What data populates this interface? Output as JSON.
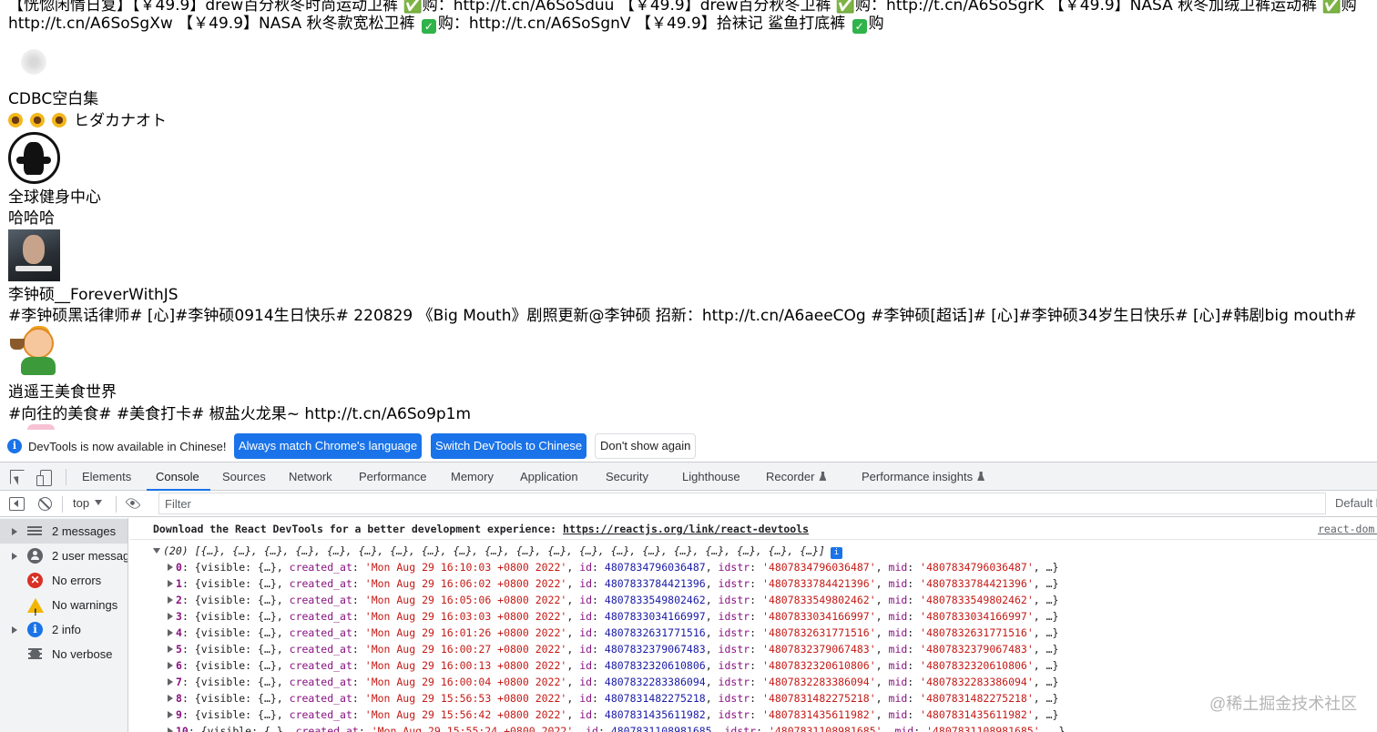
{
  "page": {
    "cut_line": "【恍惚闲情日复】【￥49.9】drew百分秋冬时尚运动卫裤 ✅购：http://t.cn/A6SoSduu 【￥49.9】drew百分秋冬卫裤 ✅购：http://t.cn/A6SoSgrK 【￥49.9】NASA 秋冬加绒卫裤运动裤 ✅购",
    "line1_a": "http://t.cn/A6SoSgXw 【￥49.9】NASA 秋冬款宽松卫裤 ",
    "line1_b": "购：http://t.cn/A6SoSgnV 【￥49.9】拾袜记 鲨鱼打底裤 ",
    "line1_c": "购",
    "check": "✓",
    "posts": [
      {
        "name": "CDBC空白集",
        "text": "ヒダカナオト"
      },
      {
        "name": "全球健身中心",
        "text": "哈哈哈"
      },
      {
        "name": "李钟硕__ForeverWithJS",
        "text": "#李钟硕黑话律师# [心]#李钟硕0914生日快乐# 220829 《Big Mouth》剧照更新@李钟硕 招新：http://t.cn/A6aeeCOg #李钟硕[超话]# [心]#李钟硕34岁生日快乐# [心]#韩剧big mouth#"
      },
      {
        "name": "逍遥王美食世界",
        "text": "#向往的美食# #美食打卡# 椒盐火龙果~  http://t.cn/A6So9p1m"
      }
    ]
  },
  "infobar": {
    "icon": "i",
    "message": "DevTools is now available in Chinese!",
    "btn_match": "Always match Chrome's language",
    "btn_switch": "Switch DevTools to Chinese",
    "btn_dismiss": "Don't show again"
  },
  "tabs": [
    "Elements",
    "Console",
    "Sources",
    "Network",
    "Performance",
    "Memory",
    "Application",
    "Security",
    "Lighthouse",
    "Recorder",
    "Performance insights"
  ],
  "active_tab": "Console",
  "toolbar": {
    "context": "top",
    "filter_placeholder": "Filter",
    "levels": "Default levels"
  },
  "sidebar": {
    "items": [
      {
        "label": "2 messages",
        "icon": "list-icon"
      },
      {
        "label": "2 user messages",
        "icon": "user-icon"
      },
      {
        "label": "No errors",
        "icon": "error-icon"
      },
      {
        "label": "No warnings",
        "icon": "warning-icon"
      },
      {
        "label": "2 info",
        "icon": "info-icon"
      },
      {
        "label": "No verbose",
        "icon": "verbose-icon"
      }
    ]
  },
  "console": {
    "react_msg": "Download the React DevTools for a better development experience: ",
    "react_link": "https://reactjs.org/link/react-devtools",
    "react_source": "react-dom.development.js",
    "array_summary": "(20) [{…}, {…}, {…}, {…}, {…}, {…}, {…}, {…}, {…}, {…}, {…}, {…}, {…}, {…}, {…}, {…}, {…}, {…}, {…}, {…}]",
    "array_badge": "i",
    "rows": [
      {
        "index": "0",
        "created_at": "'Mon Aug 29 16:10:03 +0800 2022'",
        "id": "4807834796036487",
        "idstr": "'4807834796036487'",
        "mid": "'4807834796036487'"
      },
      {
        "index": "1",
        "created_at": "'Mon Aug 29 16:06:02 +0800 2022'",
        "id": "4807833784421396",
        "idstr": "'4807833784421396'",
        "mid": "'4807833784421396'"
      },
      {
        "index": "2",
        "created_at": "'Mon Aug 29 16:05:06 +0800 2022'",
        "id": "4807833549802462",
        "idstr": "'4807833549802462'",
        "mid": "'4807833549802462'"
      },
      {
        "index": "3",
        "created_at": "'Mon Aug 29 16:03:03 +0800 2022'",
        "id": "4807833034166997",
        "idstr": "'4807833034166997'",
        "mid": "'4807833034166997'"
      },
      {
        "index": "4",
        "created_at": "'Mon Aug 29 16:01:26 +0800 2022'",
        "id": "4807832631771516",
        "idstr": "'4807832631771516'",
        "mid": "'4807832631771516'"
      },
      {
        "index": "5",
        "created_at": "'Mon Aug 29 16:00:27 +0800 2022'",
        "id": "4807832379067483",
        "idstr": "'4807832379067483'",
        "mid": "'4807832379067483'"
      },
      {
        "index": "6",
        "created_at": "'Mon Aug 29 16:00:13 +0800 2022'",
        "id": "4807832320610806",
        "idstr": "'4807832320610806'",
        "mid": "'4807832320610806'"
      },
      {
        "index": "7",
        "created_at": "'Mon Aug 29 16:00:04 +0800 2022'",
        "id": "4807832283386094",
        "idstr": "'4807832283386094'",
        "mid": "'4807832283386094'"
      },
      {
        "index": "8",
        "created_at": "'Mon Aug 29 15:56:53 +0800 2022'",
        "id": "4807831482275218",
        "idstr": "'4807831482275218'",
        "mid": "'4807831482275218'"
      },
      {
        "index": "9",
        "created_at": "'Mon Aug 29 15:56:42 +0800 2022'",
        "id": "4807831435611982",
        "idstr": "'4807831435611982'",
        "mid": "'4807831435611982'"
      },
      {
        "index": "10",
        "created_at": "'Mon Aug 29 15:55:24 +0800 2022'",
        "id": "4807831108981685",
        "idstr": "'4807831108981685'",
        "mid": "'4807831108981685'"
      }
    ],
    "row_visible": "{visible: {…}, ",
    "row_tail": ", …}"
  },
  "watermark": "@稀土掘金技术社区"
}
